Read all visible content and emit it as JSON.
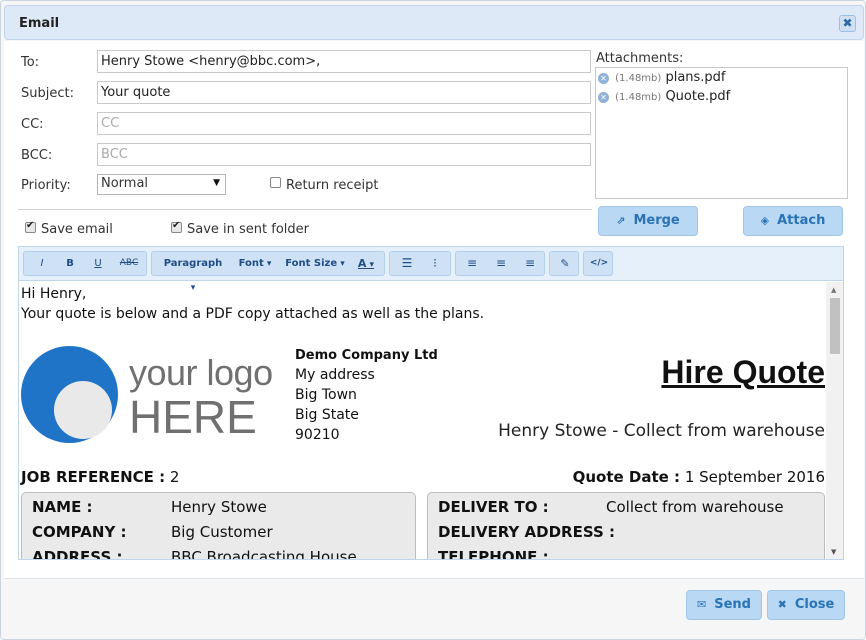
{
  "dialog": {
    "title": "Email",
    "close_glyph": "✖"
  },
  "form": {
    "to_label": "To:",
    "to_value": "Henry Stowe <henry@bbc.com>,",
    "subject_label": "Subject:",
    "subject_value": "Your quote",
    "cc_label": "CC:",
    "cc_placeholder": "CC",
    "bcc_label": "BCC:",
    "bcc_placeholder": "BCC",
    "priority_label": "Priority:",
    "priority_value": "Normal",
    "return_receipt_label": "Return receipt",
    "save_email_label": "Save email",
    "save_sent_label": "Save in sent folder"
  },
  "attachments": {
    "label": "Attachments:",
    "items": [
      {
        "size": "(1.48mb)",
        "name": "plans.pdf"
      },
      {
        "size": "(1.48mb)",
        "name": "Quote.pdf"
      }
    ]
  },
  "buttons": {
    "merge": "Merge",
    "attach": "Attach",
    "send": "Send",
    "close": "Close"
  },
  "toolbar": {
    "italic": "I",
    "bold": "B",
    "underline": "U",
    "strike": "ABC",
    "paragraph": "Paragraph",
    "font": "Font",
    "font_size": "Font Size",
    "font_color": "A"
  },
  "message": {
    "greeting": "Hi Henry,",
    "line1": "Your quote is below and a PDF copy attached as well as the plans.",
    "logo_line1": "your logo",
    "logo_line2": "HERE",
    "company": "Demo Company Ltd",
    "address": [
      "My address",
      "Big Town",
      "Big State",
      "90210"
    ],
    "quote_title": "Hire Quote",
    "quote_subtitle": "Henry Stowe - Collect from warehouse",
    "job_ref_label": "JOB REFERENCE :",
    "job_ref_value": "2",
    "quote_date_label": "Quote Date :",
    "quote_date_value": "1 September 2016",
    "left_box": [
      {
        "key": "NAME :",
        "value": "Henry Stowe"
      },
      {
        "key": "COMPANY :",
        "value": "Big Customer"
      },
      {
        "key": "ADDRESS :",
        "value": "BBC Broadcasting House"
      }
    ],
    "right_box": [
      {
        "key": "DELIVER TO :",
        "value": "Collect from warehouse"
      },
      {
        "key": "DELIVERY ADDRESS :",
        "value": ""
      },
      {
        "key": "TELEPHONE :",
        "value": ""
      }
    ]
  },
  "colors": {
    "accent": "#2a73b5",
    "button_bg": "#b9d8f3",
    "titlebar_bg": "#dde9f6",
    "logo_blue": "#1f74c8"
  }
}
